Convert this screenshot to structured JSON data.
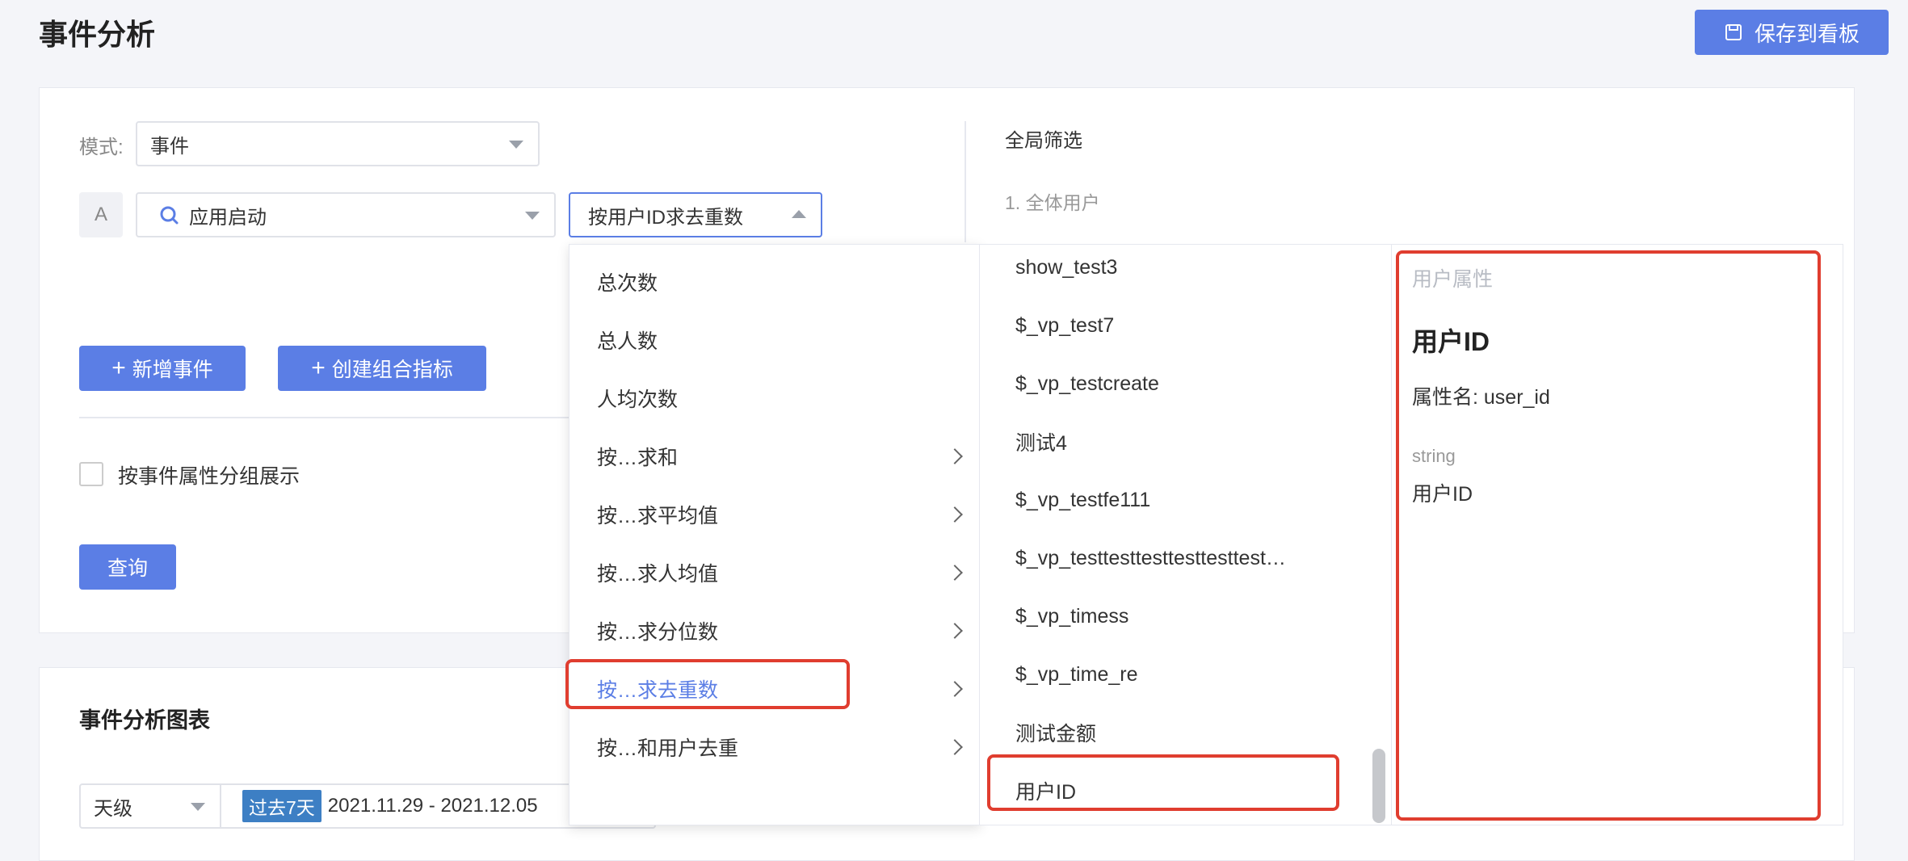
{
  "header": {
    "title": "事件分析",
    "save_label": "保存到看板"
  },
  "query": {
    "mode_label": "模式:",
    "mode_value": "事件",
    "event_badge": "A",
    "event_value": "应用启动",
    "metric_value": "按用户ID求去重数",
    "add_event_label": "新增事件",
    "create_metric_label": "创建组合指标",
    "group_by_label": "按事件属性分组展示",
    "query_button": "查询"
  },
  "global_filter": {
    "title": "全局筛选",
    "item": "1. 全体用户"
  },
  "metric_menu": {
    "items": [
      {
        "label": "总次数",
        "has_submenu": false
      },
      {
        "label": "总人数",
        "has_submenu": false
      },
      {
        "label": "人均次数",
        "has_submenu": false
      },
      {
        "label": "按…求和",
        "has_submenu": true
      },
      {
        "label": "按…求平均值",
        "has_submenu": true
      },
      {
        "label": "按…求人均值",
        "has_submenu": true
      },
      {
        "label": "按…求分位数",
        "has_submenu": true
      },
      {
        "label": "按…求去重数",
        "has_submenu": true
      },
      {
        "label": "按…和用户去重",
        "has_submenu": true
      }
    ]
  },
  "property_list": {
    "items": [
      "show_test3",
      "$_vp_test7",
      "$_vp_testcreate",
      "测试4",
      "$_vp_testfe111",
      "$_vp_testtesttesttesttesttest…",
      "$_vp_timess",
      "$_vp_time_re",
      "测试金额",
      "用户ID"
    ]
  },
  "property_detail": {
    "category": "用户属性",
    "name": "用户ID",
    "attr_line": "属性名: user_id",
    "type": "string",
    "display_name": "用户ID"
  },
  "chart_section": {
    "title": "事件分析图表",
    "granularity": "天级",
    "range_tag": "过去7天",
    "date_range": "2021.11.29 - 2021.12.05"
  },
  "colors": {
    "accent": "#5b7ee5",
    "highlight": "#e03d2f"
  }
}
